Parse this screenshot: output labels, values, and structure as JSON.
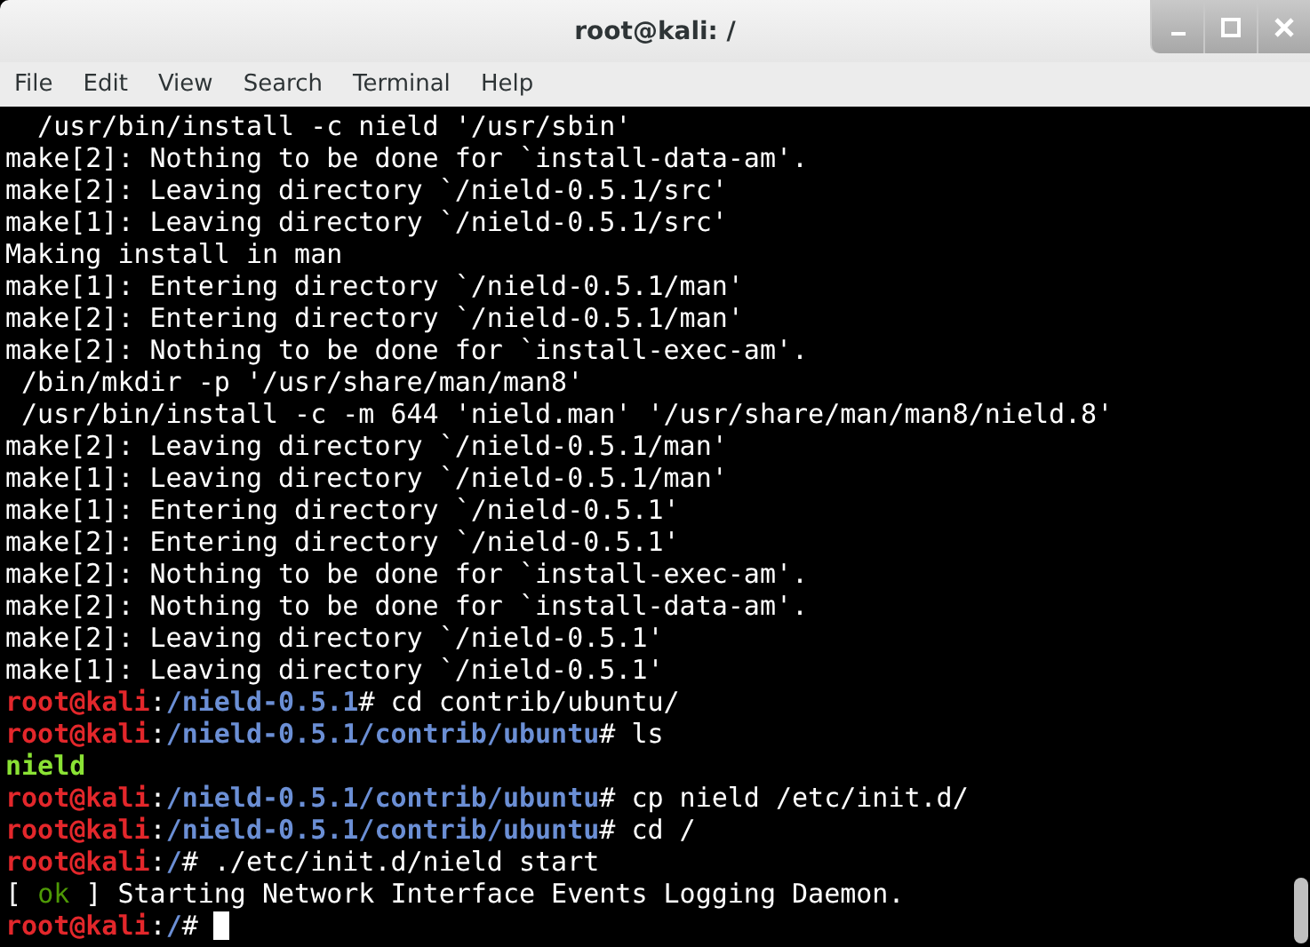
{
  "window": {
    "title": "root@kali: /"
  },
  "menu": [
    "File",
    "Edit",
    "View",
    "Search",
    "Terminal",
    "Help"
  ],
  "terminal": {
    "lines": [
      {
        "segments": [
          {
            "kind": "plain",
            "text": "  /usr/bin/install -c nield '/usr/sbin'"
          }
        ]
      },
      {
        "segments": [
          {
            "kind": "plain",
            "text": "make[2]: Nothing to be done for `install-data-am'."
          }
        ]
      },
      {
        "segments": [
          {
            "kind": "plain",
            "text": "make[2]: Leaving directory `/nield-0.5.1/src'"
          }
        ]
      },
      {
        "segments": [
          {
            "kind": "plain",
            "text": "make[1]: Leaving directory `/nield-0.5.1/src'"
          }
        ]
      },
      {
        "segments": [
          {
            "kind": "plain",
            "text": "Making install in man"
          }
        ]
      },
      {
        "segments": [
          {
            "kind": "plain",
            "text": "make[1]: Entering directory `/nield-0.5.1/man'"
          }
        ]
      },
      {
        "segments": [
          {
            "kind": "plain",
            "text": "make[2]: Entering directory `/nield-0.5.1/man'"
          }
        ]
      },
      {
        "segments": [
          {
            "kind": "plain",
            "text": "make[2]: Nothing to be done for `install-exec-am'."
          }
        ]
      },
      {
        "segments": [
          {
            "kind": "plain",
            "text": " /bin/mkdir -p '/usr/share/man/man8'"
          }
        ]
      },
      {
        "segments": [
          {
            "kind": "plain",
            "text": " /usr/bin/install -c -m 644 'nield.man' '/usr/share/man/man8/nield.8'"
          }
        ]
      },
      {
        "segments": [
          {
            "kind": "plain",
            "text": "make[2]: Leaving directory `/nield-0.5.1/man'"
          }
        ]
      },
      {
        "segments": [
          {
            "kind": "plain",
            "text": "make[1]: Leaving directory `/nield-0.5.1/man'"
          }
        ]
      },
      {
        "segments": [
          {
            "kind": "plain",
            "text": "make[1]: Entering directory `/nield-0.5.1'"
          }
        ]
      },
      {
        "segments": [
          {
            "kind": "plain",
            "text": "make[2]: Entering directory `/nield-0.5.1'"
          }
        ]
      },
      {
        "segments": [
          {
            "kind": "plain",
            "text": "make[2]: Nothing to be done for `install-exec-am'."
          }
        ]
      },
      {
        "segments": [
          {
            "kind": "plain",
            "text": "make[2]: Nothing to be done for `install-data-am'."
          }
        ]
      },
      {
        "segments": [
          {
            "kind": "plain",
            "text": "make[2]: Leaving directory `/nield-0.5.1'"
          }
        ]
      },
      {
        "segments": [
          {
            "kind": "plain",
            "text": "make[1]: Leaving directory `/nield-0.5.1'"
          }
        ]
      },
      {
        "segments": [
          {
            "kind": "user",
            "text": "root@kali"
          },
          {
            "kind": "plain",
            "text": ":"
          },
          {
            "kind": "path",
            "text": "/nield-0.5.1"
          },
          {
            "kind": "plain",
            "text": "# cd contrib/ubuntu/"
          }
        ]
      },
      {
        "segments": [
          {
            "kind": "user",
            "text": "root@kali"
          },
          {
            "kind": "plain",
            "text": ":"
          },
          {
            "kind": "path",
            "text": "/nield-0.5.1/contrib/ubuntu"
          },
          {
            "kind": "plain",
            "text": "# ls"
          }
        ]
      },
      {
        "segments": [
          {
            "kind": "exec",
            "text": "nield"
          }
        ]
      },
      {
        "segments": [
          {
            "kind": "user",
            "text": "root@kali"
          },
          {
            "kind": "plain",
            "text": ":"
          },
          {
            "kind": "path",
            "text": "/nield-0.5.1/contrib/ubuntu"
          },
          {
            "kind": "plain",
            "text": "# cp nield /etc/init.d/"
          }
        ]
      },
      {
        "segments": [
          {
            "kind": "user",
            "text": "root@kali"
          },
          {
            "kind": "plain",
            "text": ":"
          },
          {
            "kind": "path",
            "text": "/nield-0.5.1/contrib/ubuntu"
          },
          {
            "kind": "plain",
            "text": "# cd /"
          }
        ]
      },
      {
        "segments": [
          {
            "kind": "user",
            "text": "root@kali"
          },
          {
            "kind": "plain",
            "text": ":"
          },
          {
            "kind": "path",
            "text": "/"
          },
          {
            "kind": "plain",
            "text": "# ./etc/init.d/nield start"
          }
        ]
      },
      {
        "segments": [
          {
            "kind": "plain",
            "text": "[ "
          },
          {
            "kind": "ok",
            "text": "ok"
          },
          {
            "kind": "plain",
            "text": " ] Starting Network Interface Events Logging Daemon."
          }
        ]
      },
      {
        "segments": [
          {
            "kind": "user",
            "text": "root@kali"
          },
          {
            "kind": "plain",
            "text": ":"
          },
          {
            "kind": "path",
            "text": "/"
          },
          {
            "kind": "plain",
            "text": "# "
          }
        ],
        "cursor": true
      }
    ]
  }
}
